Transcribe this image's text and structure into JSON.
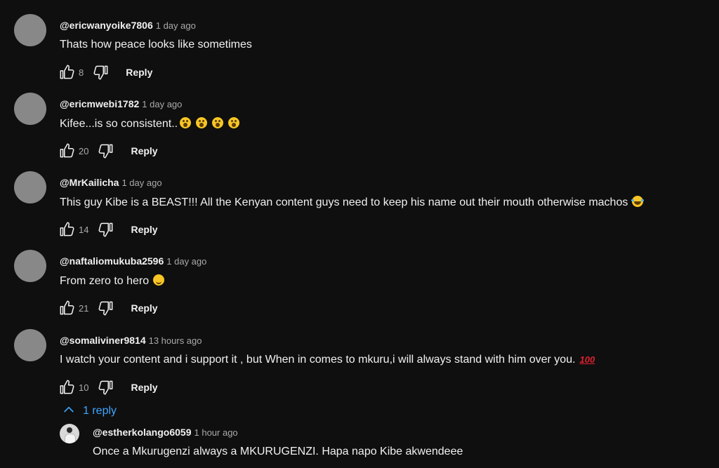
{
  "comments": [
    {
      "handle": "@ericwanyoike7806",
      "time": "1 day ago",
      "text": "Thats how peace looks like sometimes",
      "likes": "8",
      "reply_label": "Reply",
      "emojis": []
    },
    {
      "handle": "@ericmwebi1782",
      "time": "1 day ago",
      "text": "Kifee...is so consistent..",
      "likes": "20",
      "reply_label": "Reply",
      "emojis": [
        "astonished-face",
        "astonished-face",
        "astonished-face",
        "astonished-face"
      ]
    },
    {
      "handle": "@MrKailicha",
      "time": "1 day ago",
      "text": "This guy Kibe is a BEAST!!! All the Kenyan content guys need to keep his name out their mouth otherwise machos",
      "likes": "14",
      "reply_label": "Reply",
      "emojis": [
        "face-with-tears-of-joy"
      ]
    },
    {
      "handle": "@naftaliomukuba2596",
      "time": "1 day ago",
      "text": "From zero to hero",
      "likes": "21",
      "reply_label": "Reply",
      "emojis": [
        "smiling-face"
      ]
    },
    {
      "handle": "@somaliviner9814",
      "time": "13 hours ago",
      "text": "I watch your content and i support it , but When in comes to mkuru,i will always stand with him over you.",
      "likes": "10",
      "reply_label": "Reply",
      "emojis": [
        "hundred-points"
      ]
    }
  ],
  "replies_toggle": {
    "label": "1 reply",
    "icon": "chevron-up-icon",
    "color": "#3ea6ff"
  },
  "reply": {
    "handle": "@estherkolango6059",
    "time": "1 hour ago",
    "text": "Once a Mkurugenzi always a MKURUGENZI. Hapa napo Kibe akwendeee"
  },
  "colors": {
    "background": "#0f0f0f",
    "text": "#f1f1f1",
    "secondary_text": "#aaaaaa",
    "avatar_placeholder": "#888888"
  },
  "icons": {
    "like": "thumb-up-icon",
    "dislike": "thumb-down-icon"
  }
}
